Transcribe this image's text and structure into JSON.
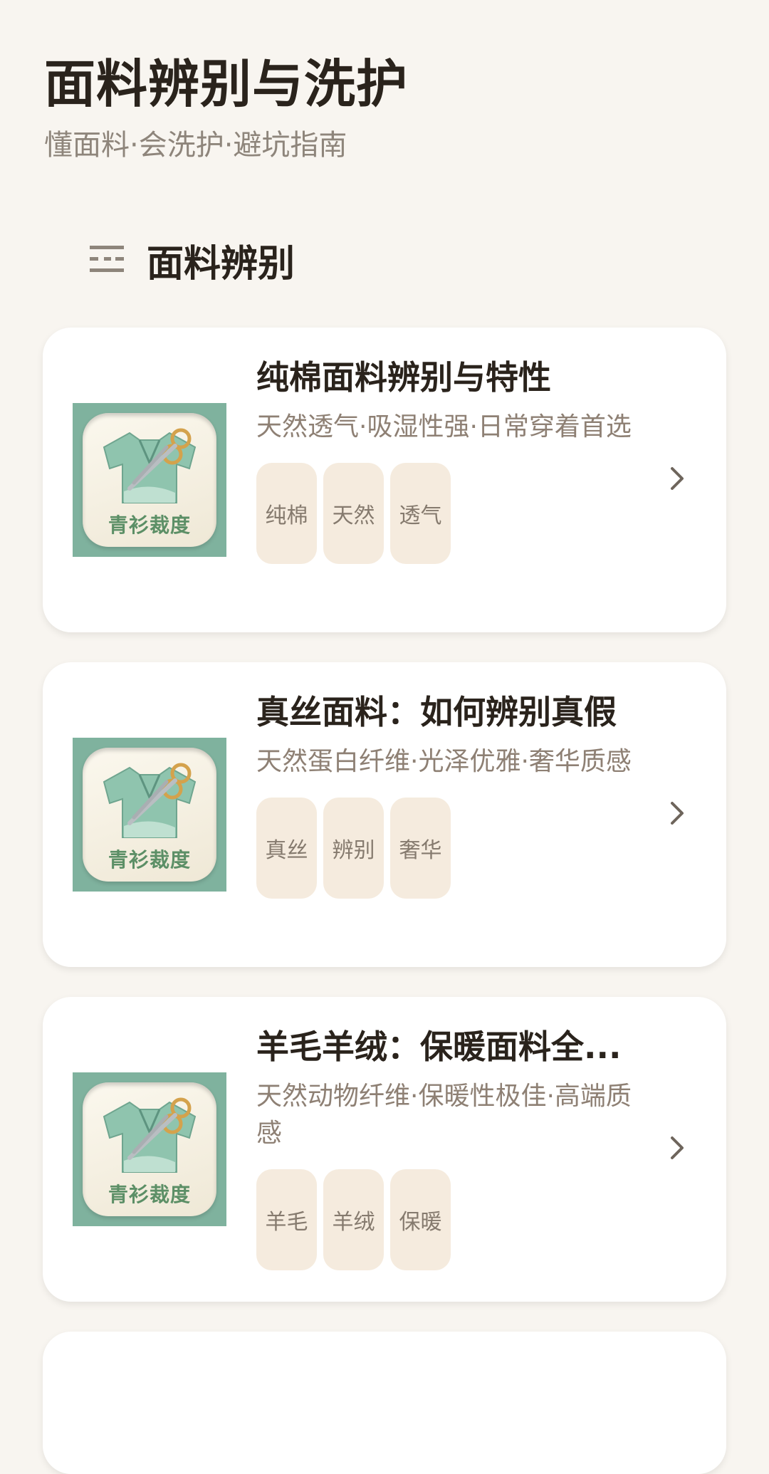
{
  "header": {
    "title": "面料辨别与洗护",
    "subtitle": "懂面料·会洗护·避坑指南"
  },
  "section": {
    "title": "面料辨别",
    "icon": "list-icon"
  },
  "thumbnail": {
    "brand_text": "青衫裁度",
    "bg_color": "#7FB29E"
  },
  "cards": [
    {
      "title": "纯棉面料辨别与特性",
      "desc": "天然透气·吸湿性强·日常穿着首选",
      "tags": [
        "纯棉",
        "天然",
        "透气"
      ]
    },
    {
      "title": "真丝面料：如何辨别真假",
      "desc": "天然蛋白纤维·光泽优雅·奢华质感",
      "tags": [
        "真丝",
        "辨别",
        "奢华"
      ]
    },
    {
      "title": "羊毛羊绒：保暖面料全...",
      "desc": "天然动物纤维·保暖性极佳·高端质感",
      "tags": [
        "羊毛",
        "羊绒",
        "保暖"
      ]
    }
  ],
  "colors": {
    "background": "#F8F5F0",
    "tag_bg": "#F5EBDE",
    "accent_green": "#5C8F66"
  }
}
